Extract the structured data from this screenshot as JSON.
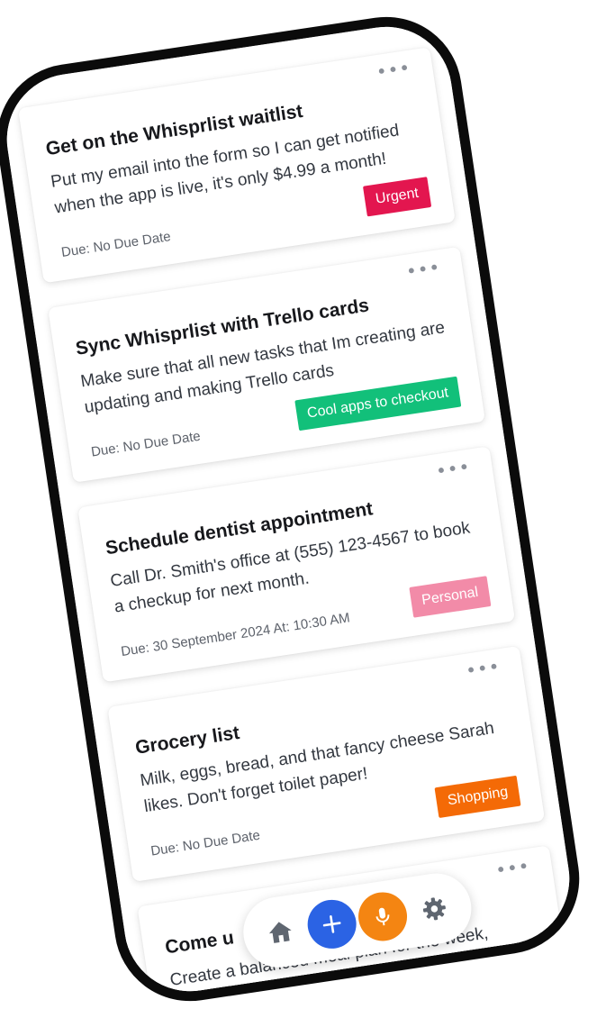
{
  "colors": {
    "urgent": "#e3164f",
    "cool_apps": "#12c07a",
    "personal": "#f28ba8",
    "shopping": "#f46a06",
    "add_button": "#2b63e4",
    "mic_button": "#f48512",
    "nav_icon": "#5f6670"
  },
  "cards": [
    {
      "title": "Get on the Whisprlist waitlist",
      "description": "Put my email into the form so I can get notified when the app is live, it's only $4.99 a month!",
      "due": "Due: No Due Date",
      "tag": "Urgent",
      "menu": "•••"
    },
    {
      "title": "Sync Whisprlist with Trello cards",
      "description": "Make sure that all new tasks that Im creating are updating and making Trello cards",
      "due": "Due: No Due Date",
      "tag": "Cool apps to checkout",
      "menu": "•••"
    },
    {
      "title": "Schedule dentist appointment",
      "description": "Call Dr. Smith's office at (555) 123-4567 to book a checkup for next month.",
      "due": "Due: 30 September 2024 At: 10:30 AM",
      "tag": "Personal",
      "menu": "•••"
    },
    {
      "title": "Grocery list",
      "description": "Milk, eggs, bread, and that fancy cheese Sarah likes. Don't forget toilet paper!",
      "due": "Due: No Due Date",
      "tag": "Shopping",
      "menu": "•••"
    },
    {
      "title": "Come u",
      "description": "Create a balanced meal plan for the week,",
      "menu": "•••"
    }
  ],
  "nav": {
    "icons": [
      "home-icon",
      "plus-icon",
      "microphone-icon",
      "gear-icon"
    ]
  }
}
